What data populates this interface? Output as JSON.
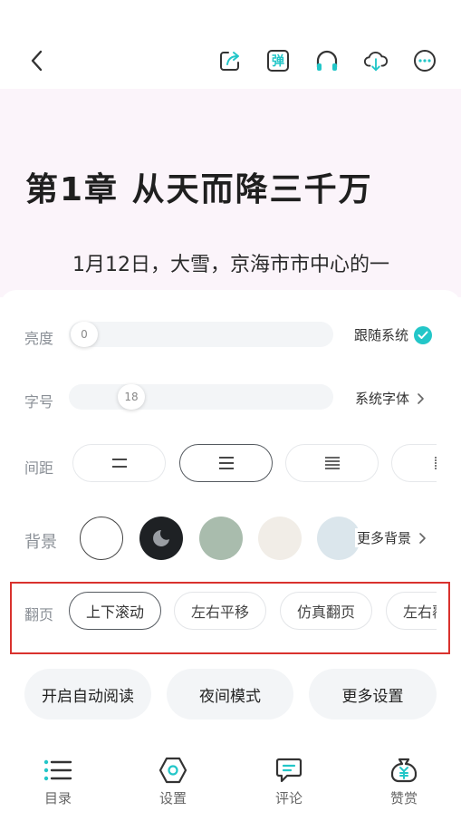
{
  "colors": {
    "accent": "#23c6c8",
    "highlight_box": "#d9322e",
    "reader_bg": "#fbf4fa"
  },
  "topbar": {
    "icons": [
      "back-arrow-icon",
      "share-icon",
      "danmaku-icon",
      "headphones-icon",
      "cloud-download-icon",
      "more-icon"
    ],
    "danmaku_label": "弹"
  },
  "reader": {
    "chapter_title": "第1章 从天而降三千万",
    "first_line": "1月12日，大雪，京海市市中心的一"
  },
  "settings": {
    "brightness": {
      "label": "亮度",
      "value": "0",
      "level": 0,
      "follow_system_label": "跟随系统",
      "follow_system": true
    },
    "font_size": {
      "label": "字号",
      "value": "18",
      "font_label": "系统字体"
    },
    "spacing": {
      "label": "间距",
      "options": [
        "tight",
        "normal",
        "loose",
        "extra-loose"
      ],
      "selected": 1
    },
    "background": {
      "label": "背景",
      "swatches": [
        "#ffffff",
        "#1e2124",
        "#a9bcad",
        "#f1ede7",
        "#dbe6ec"
      ],
      "more_label": "更多背景"
    },
    "page_flip": {
      "label": "翻页",
      "options": [
        "上下滚动",
        "左右平移",
        "仿真翻页",
        "左右覆盖"
      ],
      "selected": 0
    },
    "actions": [
      "开启自动阅读",
      "夜间模式",
      "更多设置"
    ]
  },
  "bottom_nav": [
    {
      "label": "目录",
      "icon": "menu-list-icon"
    },
    {
      "label": "设置",
      "icon": "settings-hex-icon"
    },
    {
      "label": "评论",
      "icon": "comment-icon"
    },
    {
      "label": "赞赏",
      "icon": "money-bag-icon"
    }
  ]
}
